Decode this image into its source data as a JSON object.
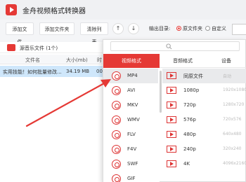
{
  "app": {
    "title": "金舟视频格式转换器"
  },
  "toolbar": {
    "add_file": "添加文件",
    "add_folder": "添加文件夹",
    "clear_list": "清除列表",
    "up_icon": "↑",
    "down_icon": "↓",
    "output_label": "输出目录:",
    "option_source": "原文件夹",
    "option_custom": "自定义"
  },
  "list": {
    "title": "源音乐文件 (1个)",
    "columns": [
      "文件名",
      "大小(mb)",
      "时"
    ],
    "rows": [
      {
        "name": "实用技能！如何批量修改...",
        "size": "34.19 MB",
        "time": "00:"
      }
    ]
  },
  "popup": {
    "tabs": [
      "视频格式",
      "音频格式",
      "设备"
    ],
    "formats": [
      "MP4",
      "AVI",
      "MKV",
      "WMV",
      "FLV",
      "F4V",
      "SWF",
      "GIF"
    ],
    "resolutions": [
      {
        "label": "同原文件",
        "dim": "自动"
      },
      {
        "label": "1080p",
        "dim": "1920x1080"
      },
      {
        "label": "720p",
        "dim": "1280x720"
      },
      {
        "label": "576p",
        "dim": "720x576"
      },
      {
        "label": "480p",
        "dim": "640x480"
      },
      {
        "label": "240p",
        "dim": "320x240"
      },
      {
        "label": "4K",
        "dim": "4096x2160"
      }
    ]
  },
  "colors": {
    "accent": "#e53935",
    "selected_row": "#cfe7fb"
  }
}
